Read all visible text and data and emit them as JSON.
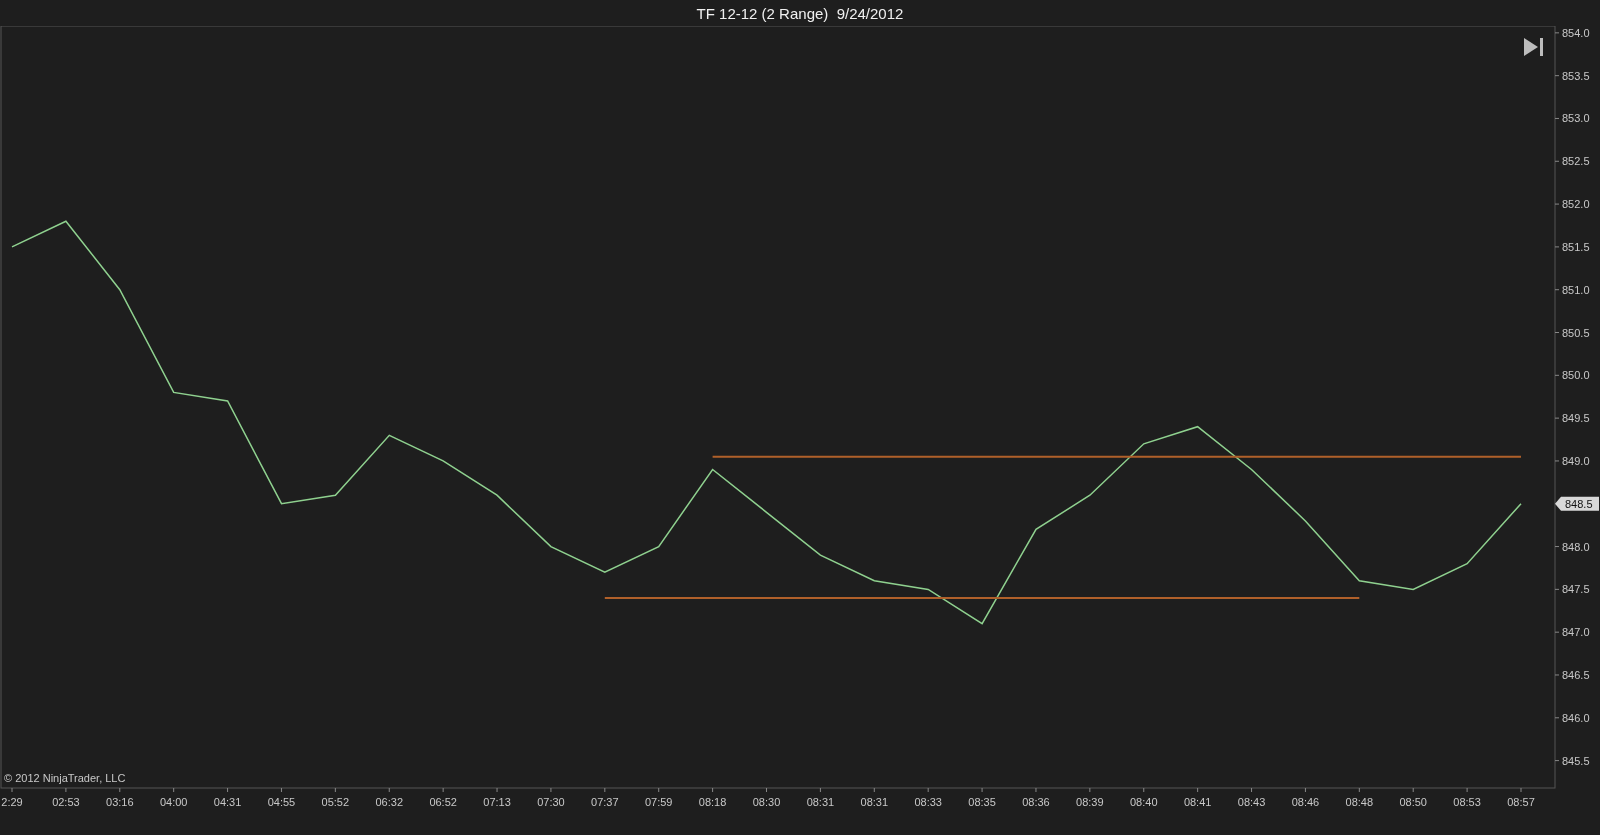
{
  "window": {
    "title": "TF 12-12 (2 Range)  9/24/2012"
  },
  "chart": {
    "copyright": "© 2012 NinjaTrader, LLC",
    "price_marker": "848.5",
    "chart_data": {
      "type": "line",
      "x": [
        "2:29",
        "02:53",
        "03:16",
        "04:00",
        "04:31",
        "04:55",
        "05:52",
        "06:32",
        "06:52",
        "07:13",
        "07:30",
        "07:37",
        "07:59",
        "08:18",
        "08:30",
        "08:31",
        "08:31",
        "08:33",
        "08:35",
        "08:36",
        "08:39",
        "08:40",
        "08:41",
        "08:43",
        "08:46",
        "08:48",
        "08:50",
        "08:53",
        "08:57"
      ],
      "series": [
        {
          "color": "#8fd18f",
          "values": [
            851.5,
            851.8,
            851.0,
            849.8,
            849.7,
            848.5,
            848.6,
            849.3,
            849.0,
            848.6,
            848.0,
            847.7,
            848.0,
            848.9,
            848.4,
            847.9,
            847.6,
            847.5,
            847.1,
            848.2,
            848.6,
            849.2,
            849.4,
            848.9,
            848.3,
            847.6,
            847.5,
            847.8,
            848.5
          ]
        },
        {
          "color": "#b0602a",
          "values": [
            null,
            null,
            null,
            null,
            null,
            null,
            null,
            null,
            null,
            null,
            null,
            null,
            null,
            849.05,
            849.05,
            849.05,
            849.05,
            849.05,
            849.05,
            849.05,
            849.05,
            849.05,
            849.05,
            849.05,
            849.05,
            849.05,
            849.05,
            849.05,
            849.05
          ]
        },
        {
          "color": "#b0602a",
          "values": [
            null,
            null,
            null,
            null,
            null,
            null,
            null,
            null,
            null,
            null,
            null,
            847.4,
            847.4,
            847.4,
            847.4,
            847.4,
            847.4,
            847.4,
            847.4,
            847.4,
            847.4,
            847.4,
            847.4,
            847.4,
            847.4,
            847.4,
            null,
            null,
            null
          ]
        }
      ],
      "ylim": [
        845.18,
        854.08
      ],
      "yticks": [
        {
          "value": 845.5,
          "label": "845.5"
        },
        {
          "value": 846.0,
          "label": "846.0"
        },
        {
          "value": 846.5,
          "label": "846.5"
        },
        {
          "value": 847.0,
          "label": "847.0"
        },
        {
          "value": 847.5,
          "label": "847.5"
        },
        {
          "value": 848.0,
          "label": "848.0"
        },
        {
          "value": 849.0,
          "label": "849.0"
        },
        {
          "value": 849.5,
          "label": "849.5"
        },
        {
          "value": 850.0,
          "label": "850.0"
        },
        {
          "value": 850.5,
          "label": "850.5"
        },
        {
          "value": 851.0,
          "label": "851.0"
        },
        {
          "value": 851.5,
          "label": "851.5"
        },
        {
          "value": 852.0,
          "label": "852.0"
        },
        {
          "value": 852.5,
          "label": "852.5"
        },
        {
          "value": 853.0,
          "label": "853.0"
        },
        {
          "value": 853.5,
          "label": "853.5"
        },
        {
          "value": 854.0,
          "label": "854.0"
        }
      ]
    }
  }
}
